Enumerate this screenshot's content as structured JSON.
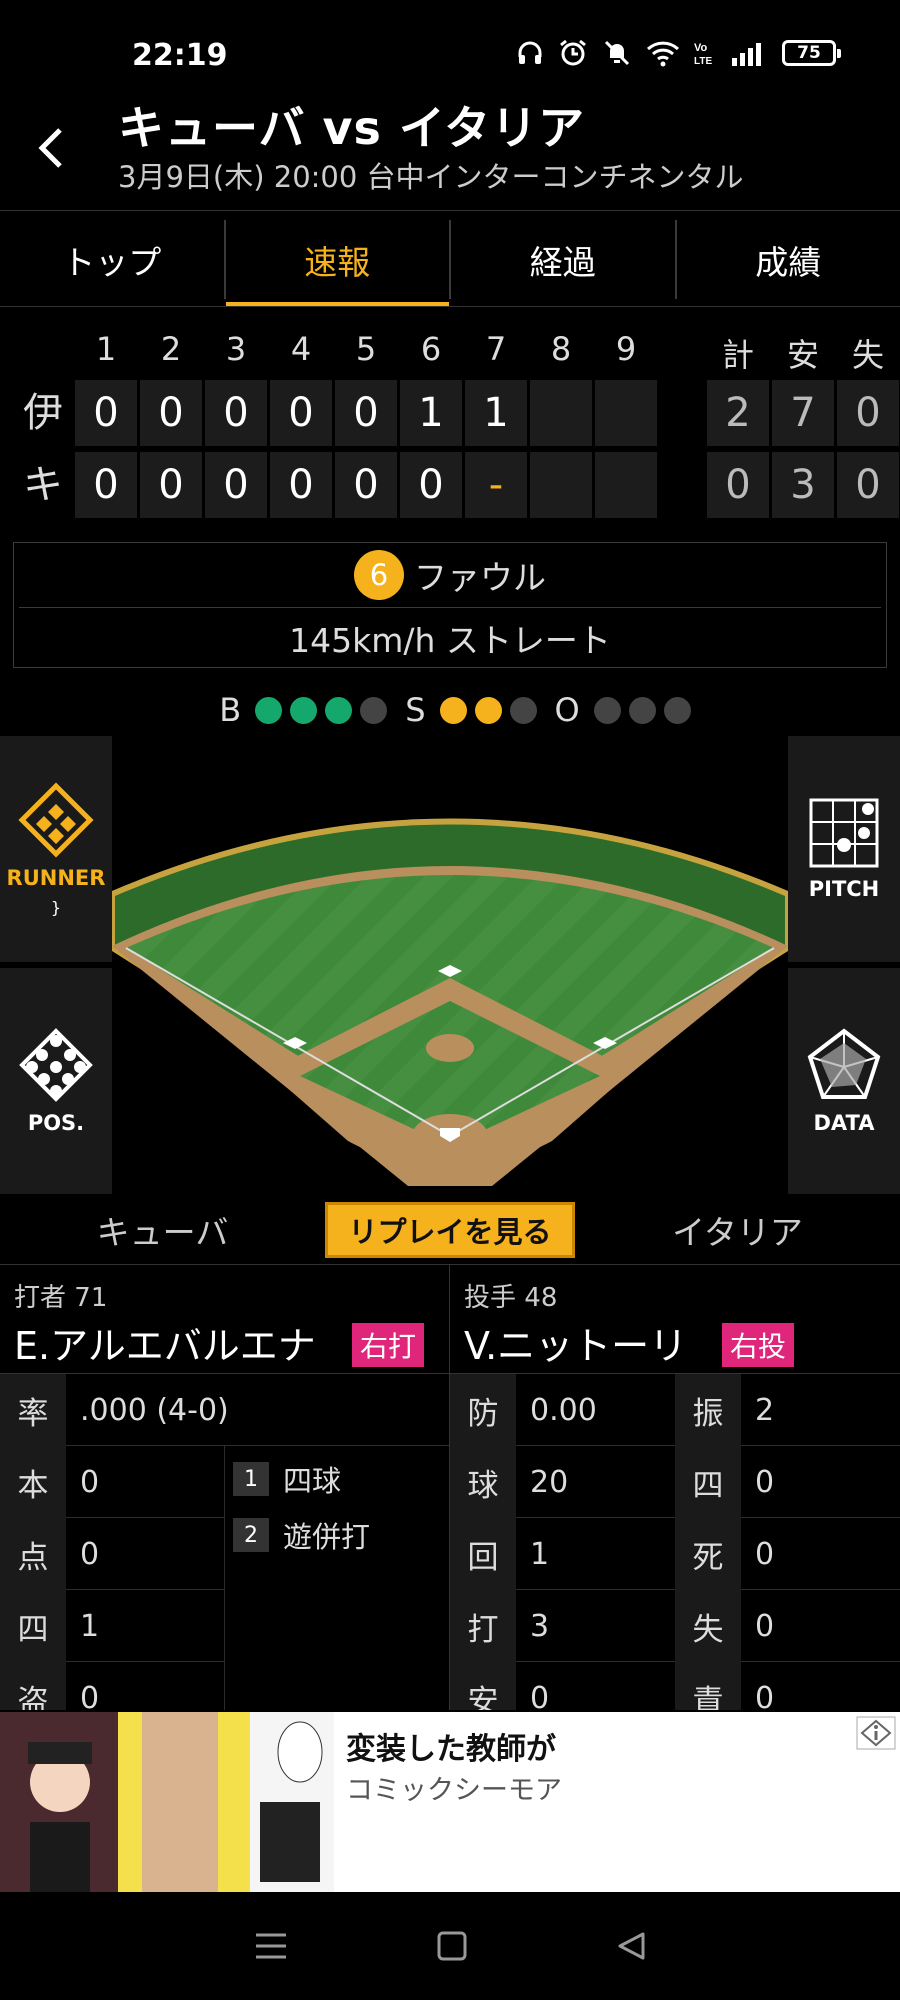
{
  "status": {
    "time": "22:19",
    "battery": "75"
  },
  "header": {
    "title": "キューバ vs イタリア",
    "subtitle": "3月9日(木) 20:00 台中インターコンチネンタル"
  },
  "tabs": [
    {
      "label": "トップ"
    },
    {
      "label": "速報"
    },
    {
      "label": "経過"
    },
    {
      "label": "成績"
    }
  ],
  "scoreboard": {
    "innings": [
      "1",
      "2",
      "3",
      "4",
      "5",
      "6",
      "7",
      "8",
      "9"
    ],
    "totals_headers": [
      "計",
      "安",
      "失"
    ],
    "teams": [
      {
        "abbr": "伊",
        "scores": [
          "0",
          "0",
          "0",
          "0",
          "0",
          "1",
          "1",
          "",
          ""
        ],
        "totals": [
          "2",
          "7",
          "0"
        ]
      },
      {
        "abbr": "キ",
        "scores": [
          "0",
          "0",
          "0",
          "0",
          "0",
          "0",
          "-",
          "",
          ""
        ],
        "totals": [
          "0",
          "3",
          "0"
        ]
      }
    ]
  },
  "play": {
    "pitch_number": "6",
    "result": "ファウル",
    "pitch": "145km/h ストレート"
  },
  "count": {
    "b_label": "B",
    "s_label": "S",
    "o_label": "O",
    "balls": 3,
    "strikes": 2,
    "outs": 0
  },
  "side_buttons": {
    "runner": "RUNNER",
    "pitch": "PITCH",
    "pos": "POS.",
    "data": "DATA"
  },
  "teams_bar": {
    "left": "キューバ",
    "replay": "リプレイを見る",
    "right": "イタリア"
  },
  "batter": {
    "label": "打者",
    "number": "71",
    "name": "E.アルエバルエナ",
    "hand": "右打"
  },
  "pitcher": {
    "label": "投手",
    "number": "48",
    "name": "V.ニットーリ",
    "hand": "右投"
  },
  "batter_stats": [
    {
      "key": "率",
      "value": ".000 (4-0)"
    },
    {
      "key": "本",
      "value": "0"
    },
    {
      "key": "点",
      "value": "0"
    },
    {
      "key": "四",
      "value": "1"
    },
    {
      "key": "盗",
      "value": "0"
    }
  ],
  "at_bat_history": [
    {
      "num": "1",
      "result": "四球"
    },
    {
      "num": "2",
      "result": "遊併打"
    }
  ],
  "pitcher_stats": [
    {
      "key": "防",
      "value": "0.00",
      "key2": "振",
      "value2": "2"
    },
    {
      "key": "球",
      "value": "20",
      "key2": "四",
      "value2": "0"
    },
    {
      "key": "回",
      "value": "1",
      "key2": "死",
      "value2": "0"
    },
    {
      "key": "打",
      "value": "3",
      "key2": "失",
      "value2": "0"
    },
    {
      "key": "安",
      "value": "0",
      "key2": "責",
      "value2": "0"
    }
  ],
  "ad": {
    "title": "変装した教師が",
    "sponsor": "コミックシーモア"
  },
  "colors": {
    "accent": "#f5b21c",
    "ball": "#14a86c",
    "badge": "#e0267a"
  }
}
